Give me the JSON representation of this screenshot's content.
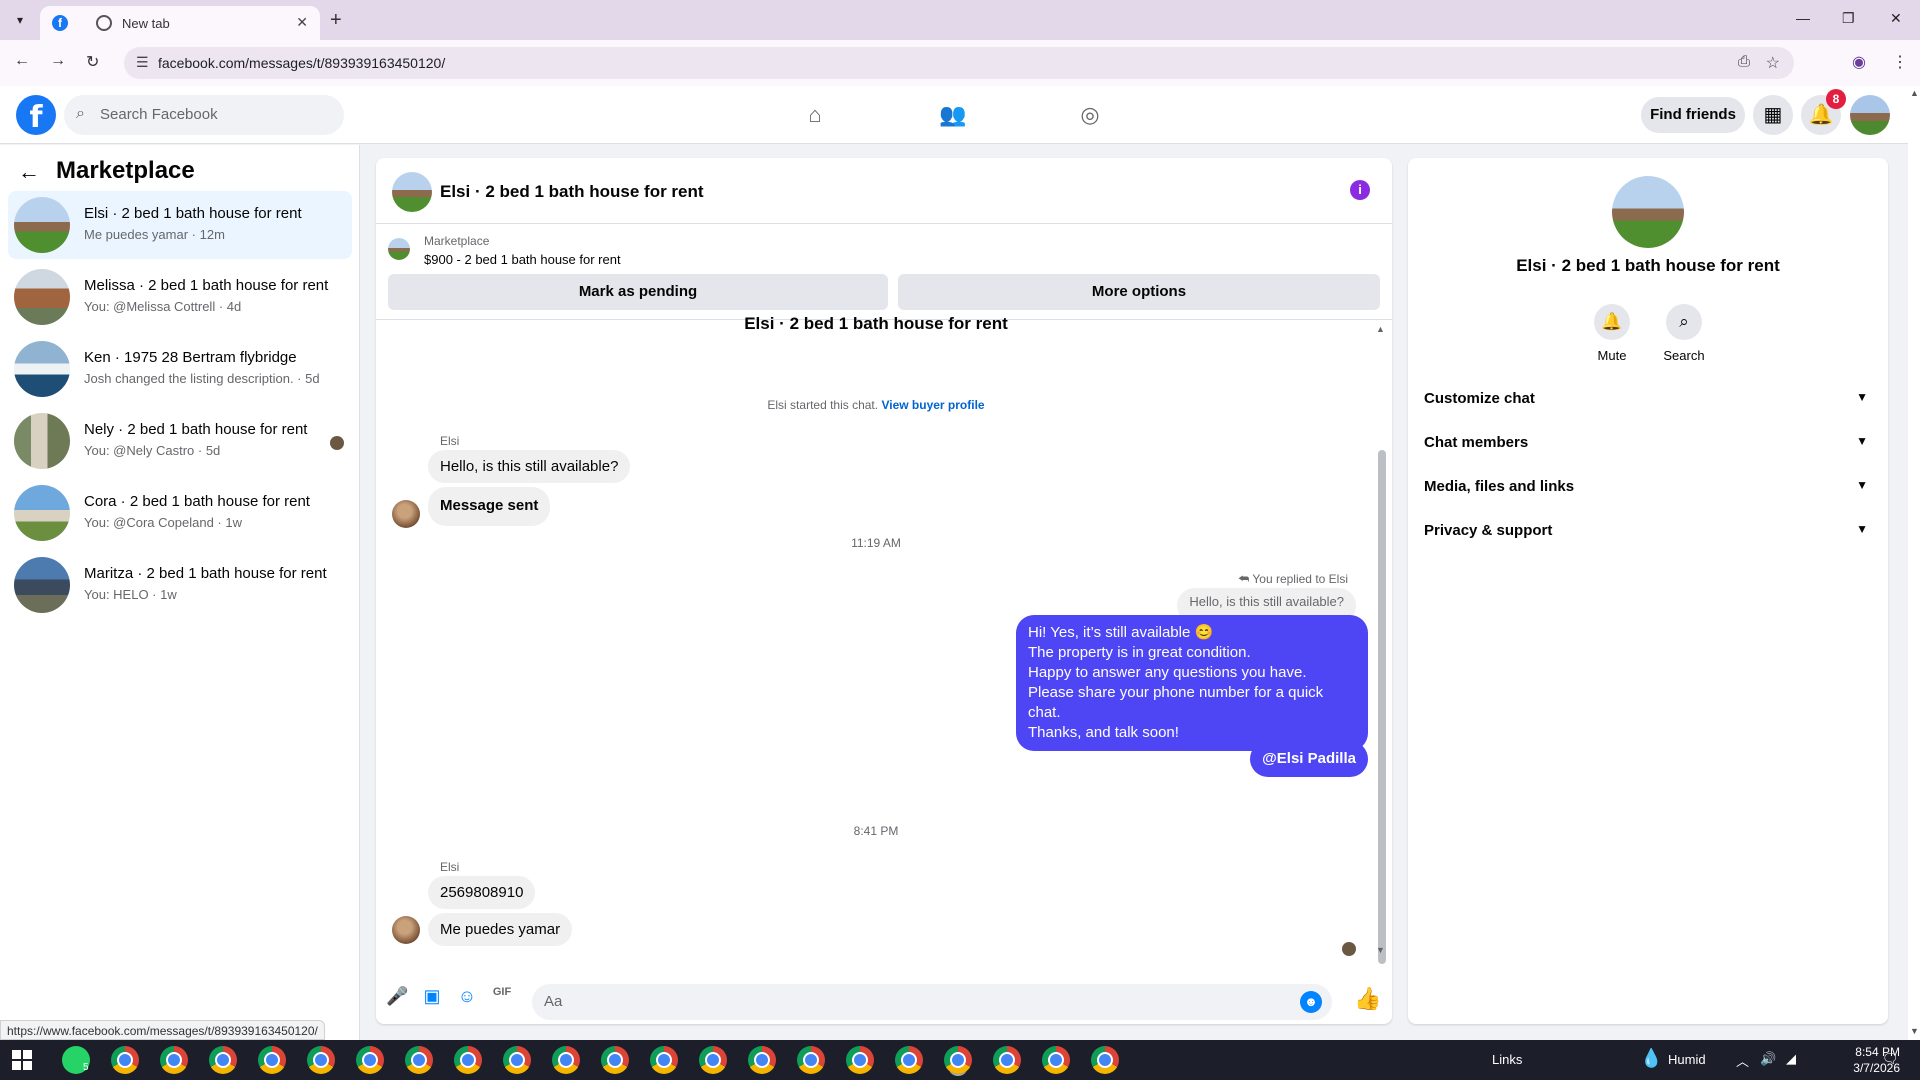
{
  "browser": {
    "tabs": [
      {
        "label": "",
        "icon": "facebook-icon",
        "active": true
      },
      {
        "label": "New tab",
        "icon": "chrome-icon",
        "active": false
      }
    ],
    "url": "facebook.com/messages/t/893939163450120/",
    "status_url": "https://www.facebook.com/messages/t/893939163450120/"
  },
  "fb_header": {
    "search_placeholder": "Search Facebook",
    "find_friends": "Find friends",
    "notification_count": "8"
  },
  "left": {
    "title": "Marketplace",
    "conversations": [
      {
        "name": "Elsi · 2 bed 1 bath house for rent",
        "sub": "Me puedes yamar · 12m",
        "selected": true
      },
      {
        "name": "Melissa · 2 bed 1 bath house for rent",
        "sub": "You: @Melissa Cottrell · 4d"
      },
      {
        "name": "Ken · 1975 28 Bertram flybridge",
        "sub": "Josh changed the listing description. · 5d"
      },
      {
        "name": "Nely · 2 bed 1 bath house for rent",
        "sub": "You: @Nely Castro · 5d"
      },
      {
        "name": "Cora · 2 bed 1 bath house for rent",
        "sub": "You: @Cora Copeland · 1w"
      },
      {
        "name": "Maritza · 2 bed 1 bath house for rent",
        "sub": "You: HELO · 1w"
      }
    ]
  },
  "chat": {
    "title": "Elsi · 2 bed 1 bath house for rent",
    "listing_category": "Marketplace",
    "listing_desc": "$900 - 2 bed 1 bath house for rent",
    "btn_pending": "Mark as pending",
    "btn_more": "More options",
    "scrolled_title": "Elsi · 2 bed 1 bath house for rent",
    "started_text": "Elsi started this chat.",
    "view_profile": "View buyer profile",
    "sender1": "Elsi",
    "msg1": "Hello, is this still available?",
    "msg2": "Message sent",
    "time1": "11:19 AM",
    "replied_to": "You replied to Elsi",
    "quoted": "Hello, is this still available?",
    "reply_lines": [
      "Hi! Yes, it’s still available 😊",
      "The property is in great condition.",
      "Happy to answer any questions you have.",
      "Please share your phone number for a quick chat.",
      "Thanks, and talk soon!"
    ],
    "mention": "@Elsi Padilla",
    "time2": "8:41 PM",
    "sender2": "Elsi",
    "msg3": "2569808910",
    "msg4": "Me puedes yamar",
    "composer_placeholder": "Aa"
  },
  "details": {
    "title": "Elsi · 2 bed 1 bath house for rent",
    "mute": "Mute",
    "search": "Search",
    "sections": [
      "Customize chat",
      "Chat members",
      "Media, files and links",
      "Privacy & support"
    ]
  },
  "taskbar": {
    "whatsapp_badge": "5",
    "links": "Links",
    "weather": "Humid",
    "time": "8:54 PM",
    "date": "3/7/2026"
  },
  "colors": {
    "fb_blue": "#1877f2",
    "outgoing_bubble": "#4e46f5",
    "messenger_blue": "#0084ff",
    "badge_red": "#e41e3f"
  }
}
